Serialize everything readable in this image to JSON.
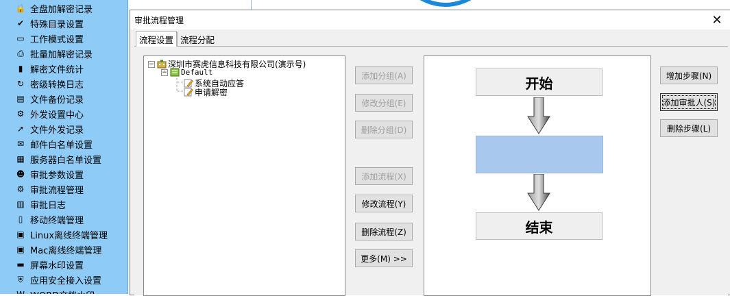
{
  "sidebar": {
    "items": [
      {
        "label": "全盘加解密记录",
        "icon": "disk-encrypt-icon"
      },
      {
        "label": "特殊目录设置",
        "icon": "special-folder-icon"
      },
      {
        "label": "工作模式设置",
        "icon": "monitor-icon"
      },
      {
        "label": "批量加解密记录",
        "icon": "printer-icon"
      },
      {
        "label": "解密文件统计",
        "icon": "bar-chart-icon"
      },
      {
        "label": "密级转换日志",
        "icon": "convert-log-icon"
      },
      {
        "label": "文件备份记录",
        "icon": "backup-icon"
      },
      {
        "label": "外发设置中心",
        "icon": "gears-icon"
      },
      {
        "label": "文件外发记录",
        "icon": "outgoing-file-icon"
      },
      {
        "label": "邮件白名单设置",
        "icon": "mail-icon"
      },
      {
        "label": "服务器白名单设置",
        "icon": "server-icon"
      },
      {
        "label": "审批参数设置",
        "icon": "user-settings-icon"
      },
      {
        "label": "审批流程管理",
        "icon": "flow-gears-icon"
      },
      {
        "label": "审批日志",
        "icon": "log-book-icon"
      },
      {
        "label": "移动终端管理",
        "icon": "mobile-icon"
      },
      {
        "label": "Linux离线终端管理",
        "icon": "linux-terminal-icon"
      },
      {
        "label": "Mac离线终端管理",
        "icon": "mac-terminal-icon"
      },
      {
        "label": "屏幕水印设置",
        "icon": "screen-watermark-icon"
      },
      {
        "label": "应用安全接入设置",
        "icon": "app-security-icon"
      },
      {
        "label": "WORD文档水印",
        "icon": "word-watermark-icon"
      }
    ]
  },
  "dialog": {
    "title": "审批流程管理",
    "close_glyph": "✕",
    "tabs": [
      "流程设置",
      "流程分配"
    ],
    "tree": {
      "root": "深圳市赛虎信息科技有限公司(演示号)",
      "group": "Default",
      "flows": [
        "系统自动应答",
        "申请解密"
      ],
      "root_expander": "−",
      "group_expander": "−"
    },
    "middle_buttons": {
      "add_group": "添加分组(A)",
      "edit_group": "修改分组(E)",
      "delete_group": "删除分组(D)",
      "add_flow": "添加流程(X)",
      "edit_flow": "修改流程(Y)",
      "delete_flow": "删除流程(Z)",
      "more": "更多(M) >>"
    },
    "flow_chart": {
      "start_label": "开始",
      "end_label": "结束",
      "step_color": "#a8c8ee"
    },
    "right_buttons": {
      "add_step": "增加步骤(N)",
      "add_approver": "添加审批人(S)",
      "delete_step": "删除步骤(L)"
    }
  },
  "colors": {
    "sidebar_bg": "#8ecbf6",
    "dialog_bg": "#f0f0f0",
    "button_bg": "#e1e1e1",
    "disabled_text": "#a0a0a0"
  }
}
